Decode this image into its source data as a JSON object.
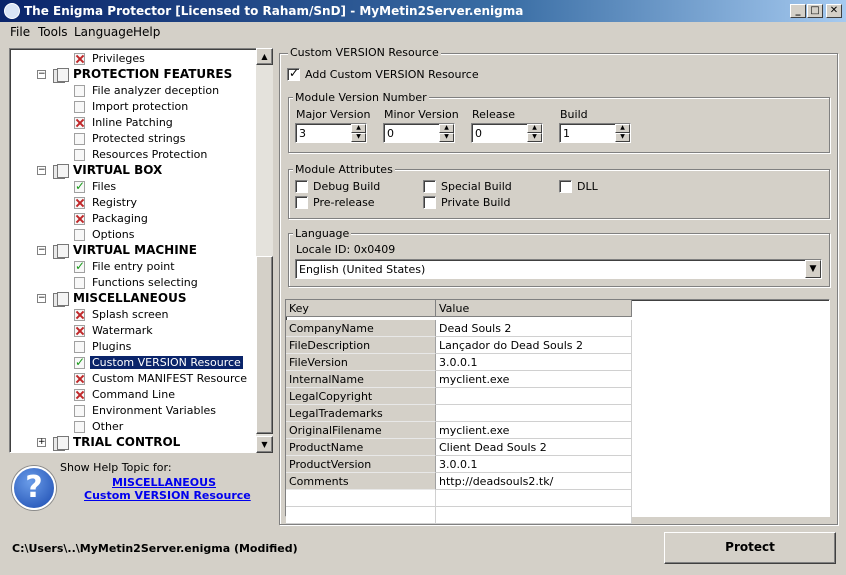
{
  "window": {
    "title": "The Enigma Protector [Licensed to Raham/SnD] - MyMetin2Server.enigma",
    "minimize": "_",
    "maximize": "□",
    "close": "✕"
  },
  "menu": [
    "File",
    "Tools",
    "Language",
    "Help"
  ],
  "tree": {
    "rows": [
      {
        "label": "Privileges",
        "kind": "item",
        "state": "x"
      },
      {
        "label": "PROTECTION FEATURES",
        "kind": "cat"
      },
      {
        "label": "File analyzer deception",
        "kind": "item",
        "state": "none"
      },
      {
        "label": "Import protection",
        "kind": "item",
        "state": "none"
      },
      {
        "label": "Inline Patching",
        "kind": "item",
        "state": "x"
      },
      {
        "label": "Protected strings",
        "kind": "item",
        "state": "none"
      },
      {
        "label": "Resources Protection",
        "kind": "item",
        "state": "none"
      },
      {
        "label": "VIRTUAL BOX",
        "kind": "cat"
      },
      {
        "label": "Files",
        "kind": "item",
        "state": "check"
      },
      {
        "label": "Registry",
        "kind": "item",
        "state": "x"
      },
      {
        "label": "Packaging",
        "kind": "item",
        "state": "x"
      },
      {
        "label": "Options",
        "kind": "item",
        "state": "none"
      },
      {
        "label": "VIRTUAL MACHINE",
        "kind": "cat"
      },
      {
        "label": "File entry point",
        "kind": "item",
        "state": "check"
      },
      {
        "label": "Functions selecting",
        "kind": "item",
        "state": "none"
      },
      {
        "label": "MISCELLANEOUS",
        "kind": "cat"
      },
      {
        "label": "Splash screen",
        "kind": "item",
        "state": "x"
      },
      {
        "label": "Watermark",
        "kind": "item",
        "state": "x"
      },
      {
        "label": "Plugins",
        "kind": "item",
        "state": "none"
      },
      {
        "label": "Custom VERSION Resource",
        "kind": "item",
        "state": "check",
        "selected": true
      },
      {
        "label": "Custom MANIFEST Resource",
        "kind": "item",
        "state": "x"
      },
      {
        "label": "Command Line",
        "kind": "item",
        "state": "x"
      },
      {
        "label": "Environment Variables",
        "kind": "item",
        "state": "none"
      },
      {
        "label": "Other",
        "kind": "item",
        "state": "none"
      },
      {
        "label": "TRIAL CONTROL",
        "kind": "cat",
        "collapsed": true
      }
    ]
  },
  "help": {
    "caption": "Show Help Topic for:",
    "link1": "MISCELLANEOUS",
    "link2": "Custom VERSION Resource"
  },
  "status": "C:\\Users\\..\\MyMetin2Server.enigma  (Modified)",
  "protect_label": "Protect",
  "panel": {
    "title": "Custom VERSION Resource",
    "add_label": "Add Custom VERSION Resource",
    "version_group": "Module Version Number",
    "major_label": "Major Version",
    "major": "3",
    "minor_label": "Minor Version",
    "minor": "0",
    "release_label": "Release",
    "release": "0",
    "build_label": "Build",
    "build": "1",
    "attr_group": "Module Attributes",
    "attrs": {
      "debug": "Debug Build",
      "special": "Special Build",
      "dll": "DLL",
      "prerelease": "Pre-release",
      "private": "Private Build"
    },
    "lang_group": "Language",
    "locale": "Locale ID: 0x0409",
    "language": "English (United States)"
  },
  "grid": {
    "headers": [
      "Key",
      "Value"
    ],
    "rows": [
      [
        "CompanyName",
        "Dead Souls 2"
      ],
      [
        "FileDescription",
        "Lançador do Dead Souls 2"
      ],
      [
        "FileVersion",
        "3.0.0.1"
      ],
      [
        "InternalName",
        "myclient.exe"
      ],
      [
        "LegalCopyright",
        ""
      ],
      [
        "LegalTrademarks",
        ""
      ],
      [
        "OriginalFilename",
        "myclient.exe"
      ],
      [
        "ProductName",
        "Client Dead Souls 2"
      ],
      [
        "ProductVersion",
        "3.0.0.1"
      ],
      [
        "Comments",
        "http://deadsouls2.tk/"
      ]
    ]
  }
}
